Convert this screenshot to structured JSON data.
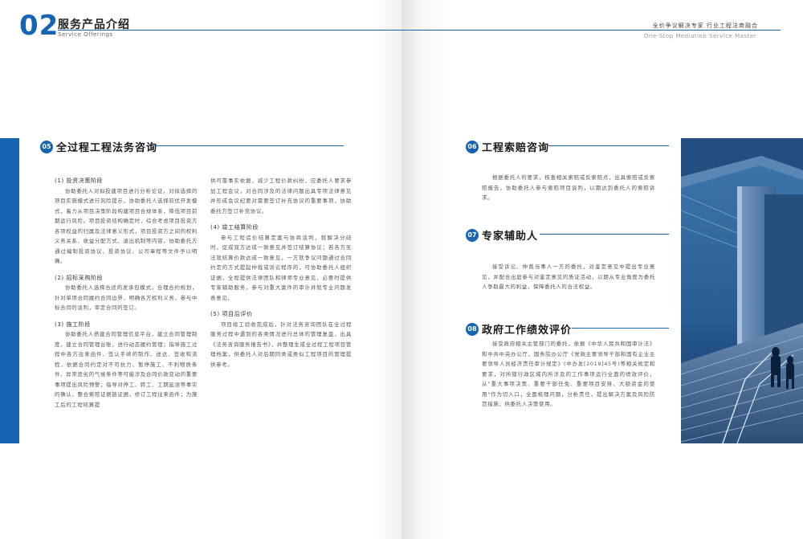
{
  "header": {
    "number": "02",
    "title_cn": "服务产品介绍",
    "title_en": "Service Offerings",
    "right_cn": "全价争议解决专家  行业工程法商融合",
    "right_en": "One-Stop Mediation Service Master"
  },
  "colors": {
    "accent": "#1664b4"
  },
  "sections": {
    "s05": {
      "badge": "05",
      "title": "全过程工程法务咨询",
      "col1": [
        {
          "heading": "(1) 投资决策阶段",
          "text": "协助委托人对拟投建项目进行分析论证，对拟选择的项目实施模式进行风险提示，协助委托人选择较优开发模式，着力从项目决策阶段构建项目合规体系，降低项目前期运行风险。项目投资结构确定时，综合考虑项目投资方各项权益的归属及法律意义形式，项目投资方之间的权利义务关系、收益分配方式、退出机制等内容，协助委托方通过编制投资协议、投资协议、公司章程等文件予以明确。"
        },
        {
          "heading": "(2) 招标采购阶段",
          "text": "协助委托人选择合适的发承包模式，合理合约规划，针对单项合同履约合同边界，明确各方权利义务，参与中标合同的谈判，审定合同的签订。"
        },
        {
          "heading": "(3) 施工阶段",
          "text": "协助委托人搭建合同管理信息平台，建立合同管理制度，建立合同管理台账，进行动态履约管理；指导施工过程中各方往来函件、签认手续的制作、送达、签收和流程，依据合同约定对不可抗力、暂停施工、不利物质条件、异常恶劣的气候条件等可能涉及合同价款变动的重要事项提出风险预警；指导对停工、转工、工期延误等事实的确认，整合索赔证据链证据，修订工程往来函件；为施工后的工程结算提"
        }
      ],
      "col2": [
        {
          "heading": "",
          "text": "供可靠事实依据，减少工程价款纠纷，应委托人要求参加工程会议，对合同涉及的法律问题出具专项法律意见并形成会议纪要对需要签订补充协议的重要事项，协助委托方签订补充协议。"
        },
        {
          "heading": "(4) 竣工结算阶段",
          "text": "参与工程造价结算定案与协商谈判，就解决分歧时，促成双方达成一致意见并签订结算协议；若各方无法就结算价款达成一致意见，一方就争议问题通过合同约定的方式提起仲裁或诉讼程序的，可协助委托人组织证据，全程提供法律团队和律师专业意见，必要时提供专家辅助服务，参与对重大案件的审计并就专业问题发表意见。"
        },
        {
          "heading": "(5) 项目后评价",
          "text": "项目竣工验收完成后，针对法务咨询团队在全过程服务过程中遇到的各类情况进行总体的管理复盘，出具《法务咨询服务报告书》，并整理生成全过程工程项目管理档案，供委托人对后期同类或类似工程项目的管理提供参考。"
        }
      ]
    },
    "s06": {
      "badge": "06",
      "title": "工程索赔咨询",
      "text": "根据委托人的要求，核查相关索赔或反索赔点，出具索赔或反索赔报告，协助委托人参与索赔项目谈判，以期达到委托人的索赔诉求。"
    },
    "s07": {
      "badge": "07",
      "title": "专家辅助人",
      "text": "接受诉讼、仲裁当事人一方的委托，对鉴定意见中提出专业意见，并配合出庭参与对鉴定意见的质证活动，以期从专业角度为委托人争取最大的利益，保障委托人的合法权益。"
    },
    "s08": {
      "badge": "08",
      "title": "政府工作绩效评价",
      "text": "接受政府相关主管部门的委托，依据《中华人民共和国审计法》和中共中央办公厅、国务院办公厅《党政主要领导干部和国有企业主要领导人员经济责任审计规定》(中办发[2019]45号)等相关规定和要求，对所辖行政区域内所涉及的工作事项运行全面的绩效评价，从\"重大事项决策、重要干部任免、重要项目安排、大额资金的使用\"作为切入口，全面梳理问题，分析责任，提出解决方案及风险防范措施，供委托人决策使用。"
    }
  }
}
